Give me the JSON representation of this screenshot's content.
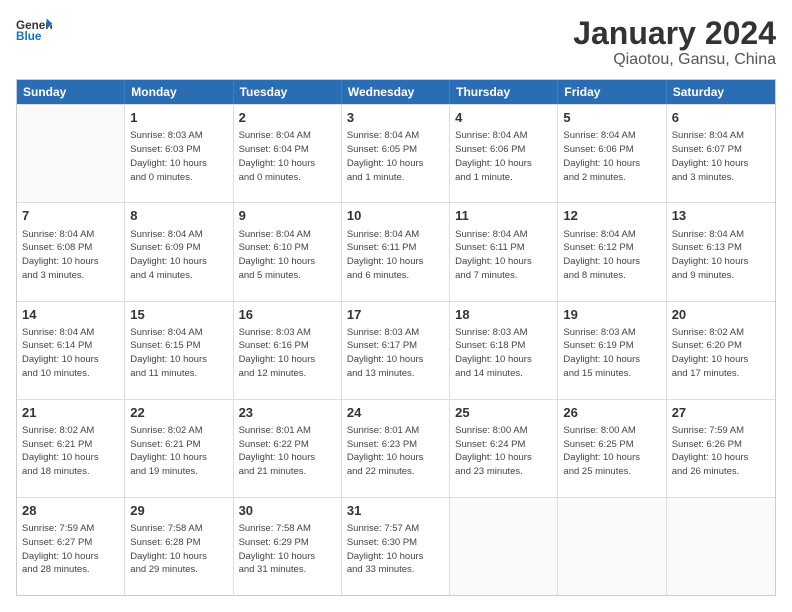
{
  "header": {
    "logo_line1": "General",
    "logo_line2": "Blue",
    "main_title": "January 2024",
    "subtitle": "Qiaotou, Gansu, China"
  },
  "calendar": {
    "weekdays": [
      "Sunday",
      "Monday",
      "Tuesday",
      "Wednesday",
      "Thursday",
      "Friday",
      "Saturday"
    ],
    "weeks": [
      [
        {
          "day": "",
          "empty": true,
          "text": ""
        },
        {
          "day": "1",
          "empty": false,
          "text": "Sunrise: 8:03 AM\nSunset: 6:03 PM\nDaylight: 10 hours\nand 0 minutes."
        },
        {
          "day": "2",
          "empty": false,
          "text": "Sunrise: 8:04 AM\nSunset: 6:04 PM\nDaylight: 10 hours\nand 0 minutes."
        },
        {
          "day": "3",
          "empty": false,
          "text": "Sunrise: 8:04 AM\nSunset: 6:05 PM\nDaylight: 10 hours\nand 1 minute."
        },
        {
          "day": "4",
          "empty": false,
          "text": "Sunrise: 8:04 AM\nSunset: 6:06 PM\nDaylight: 10 hours\nand 1 minute."
        },
        {
          "day": "5",
          "empty": false,
          "text": "Sunrise: 8:04 AM\nSunset: 6:06 PM\nDaylight: 10 hours\nand 2 minutes."
        },
        {
          "day": "6",
          "empty": false,
          "text": "Sunrise: 8:04 AM\nSunset: 6:07 PM\nDaylight: 10 hours\nand 3 minutes."
        }
      ],
      [
        {
          "day": "7",
          "empty": false,
          "text": "Sunrise: 8:04 AM\nSunset: 6:08 PM\nDaylight: 10 hours\nand 3 minutes."
        },
        {
          "day": "8",
          "empty": false,
          "text": "Sunrise: 8:04 AM\nSunset: 6:09 PM\nDaylight: 10 hours\nand 4 minutes."
        },
        {
          "day": "9",
          "empty": false,
          "text": "Sunrise: 8:04 AM\nSunset: 6:10 PM\nDaylight: 10 hours\nand 5 minutes."
        },
        {
          "day": "10",
          "empty": false,
          "text": "Sunrise: 8:04 AM\nSunset: 6:11 PM\nDaylight: 10 hours\nand 6 minutes."
        },
        {
          "day": "11",
          "empty": false,
          "text": "Sunrise: 8:04 AM\nSunset: 6:11 PM\nDaylight: 10 hours\nand 7 minutes."
        },
        {
          "day": "12",
          "empty": false,
          "text": "Sunrise: 8:04 AM\nSunset: 6:12 PM\nDaylight: 10 hours\nand 8 minutes."
        },
        {
          "day": "13",
          "empty": false,
          "text": "Sunrise: 8:04 AM\nSunset: 6:13 PM\nDaylight: 10 hours\nand 9 minutes."
        }
      ],
      [
        {
          "day": "14",
          "empty": false,
          "text": "Sunrise: 8:04 AM\nSunset: 6:14 PM\nDaylight: 10 hours\nand 10 minutes."
        },
        {
          "day": "15",
          "empty": false,
          "text": "Sunrise: 8:04 AM\nSunset: 6:15 PM\nDaylight: 10 hours\nand 11 minutes."
        },
        {
          "day": "16",
          "empty": false,
          "text": "Sunrise: 8:03 AM\nSunset: 6:16 PM\nDaylight: 10 hours\nand 12 minutes."
        },
        {
          "day": "17",
          "empty": false,
          "text": "Sunrise: 8:03 AM\nSunset: 6:17 PM\nDaylight: 10 hours\nand 13 minutes."
        },
        {
          "day": "18",
          "empty": false,
          "text": "Sunrise: 8:03 AM\nSunset: 6:18 PM\nDaylight: 10 hours\nand 14 minutes."
        },
        {
          "day": "19",
          "empty": false,
          "text": "Sunrise: 8:03 AM\nSunset: 6:19 PM\nDaylight: 10 hours\nand 15 minutes."
        },
        {
          "day": "20",
          "empty": false,
          "text": "Sunrise: 8:02 AM\nSunset: 6:20 PM\nDaylight: 10 hours\nand 17 minutes."
        }
      ],
      [
        {
          "day": "21",
          "empty": false,
          "text": "Sunrise: 8:02 AM\nSunset: 6:21 PM\nDaylight: 10 hours\nand 18 minutes."
        },
        {
          "day": "22",
          "empty": false,
          "text": "Sunrise: 8:02 AM\nSunset: 6:21 PM\nDaylight: 10 hours\nand 19 minutes."
        },
        {
          "day": "23",
          "empty": false,
          "text": "Sunrise: 8:01 AM\nSunset: 6:22 PM\nDaylight: 10 hours\nand 21 minutes."
        },
        {
          "day": "24",
          "empty": false,
          "text": "Sunrise: 8:01 AM\nSunset: 6:23 PM\nDaylight: 10 hours\nand 22 minutes."
        },
        {
          "day": "25",
          "empty": false,
          "text": "Sunrise: 8:00 AM\nSunset: 6:24 PM\nDaylight: 10 hours\nand 23 minutes."
        },
        {
          "day": "26",
          "empty": false,
          "text": "Sunrise: 8:00 AM\nSunset: 6:25 PM\nDaylight: 10 hours\nand 25 minutes."
        },
        {
          "day": "27",
          "empty": false,
          "text": "Sunrise: 7:59 AM\nSunset: 6:26 PM\nDaylight: 10 hours\nand 26 minutes."
        }
      ],
      [
        {
          "day": "28",
          "empty": false,
          "text": "Sunrise: 7:59 AM\nSunset: 6:27 PM\nDaylight: 10 hours\nand 28 minutes."
        },
        {
          "day": "29",
          "empty": false,
          "text": "Sunrise: 7:58 AM\nSunset: 6:28 PM\nDaylight: 10 hours\nand 29 minutes."
        },
        {
          "day": "30",
          "empty": false,
          "text": "Sunrise: 7:58 AM\nSunset: 6:29 PM\nDaylight: 10 hours\nand 31 minutes."
        },
        {
          "day": "31",
          "empty": false,
          "text": "Sunrise: 7:57 AM\nSunset: 6:30 PM\nDaylight: 10 hours\nand 33 minutes."
        },
        {
          "day": "",
          "empty": true,
          "text": ""
        },
        {
          "day": "",
          "empty": true,
          "text": ""
        },
        {
          "day": "",
          "empty": true,
          "text": ""
        }
      ]
    ]
  }
}
